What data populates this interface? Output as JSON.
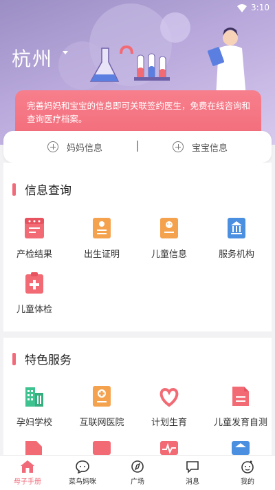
{
  "status": {
    "time": "3:10"
  },
  "header": {
    "city": "杭州"
  },
  "notice": {
    "text": "完善妈妈和宝宝的信息即可关联签约医生，免费在线咨询和查询医疗档案。"
  },
  "info_buttons": {
    "mom": "妈妈信息",
    "baby": "宝宝信息"
  },
  "sections": {
    "info_query": {
      "title": "信息查询",
      "items": [
        {
          "label": "产检结果",
          "icon": "prenatal-report-icon",
          "color": "#f26a74"
        },
        {
          "label": "出生证明",
          "icon": "birth-certificate-icon",
          "color": "#f5a24f"
        },
        {
          "label": "儿童信息",
          "icon": "child-info-icon",
          "color": "#f5a24f"
        },
        {
          "label": "服务机构",
          "icon": "institution-icon",
          "color": "#4a8fe0"
        },
        {
          "label": "儿童体检",
          "icon": "child-checkup-icon",
          "color": "#f26a74"
        }
      ]
    },
    "featured": {
      "title": "特色服务",
      "items": [
        {
          "label": "孕妇学校",
          "icon": "school-building-icon",
          "color": "#3ec28f"
        },
        {
          "label": "互联网医院",
          "icon": "internet-hospital-icon",
          "color": "#f5a24f"
        },
        {
          "label": "计划生育",
          "icon": "family-planning-icon",
          "color": "#f26a74"
        },
        {
          "label": "儿童发育自测",
          "icon": "development-test-icon",
          "color": "#f26a74"
        }
      ]
    }
  },
  "tabbar": [
    {
      "label": "母子手册",
      "icon": "home-icon",
      "active": true
    },
    {
      "label": "菜鸟妈咪",
      "icon": "chat-bubble-icon",
      "active": false
    },
    {
      "label": "广场",
      "icon": "compass-icon",
      "active": false
    },
    {
      "label": "消息",
      "icon": "message-icon",
      "active": false
    },
    {
      "label": "我的",
      "icon": "profile-face-icon",
      "active": false
    }
  ],
  "colors": {
    "accent": "#f06b7a",
    "hero_gradient": [
      "#9b8ec4",
      "#d8c9ee"
    ]
  }
}
